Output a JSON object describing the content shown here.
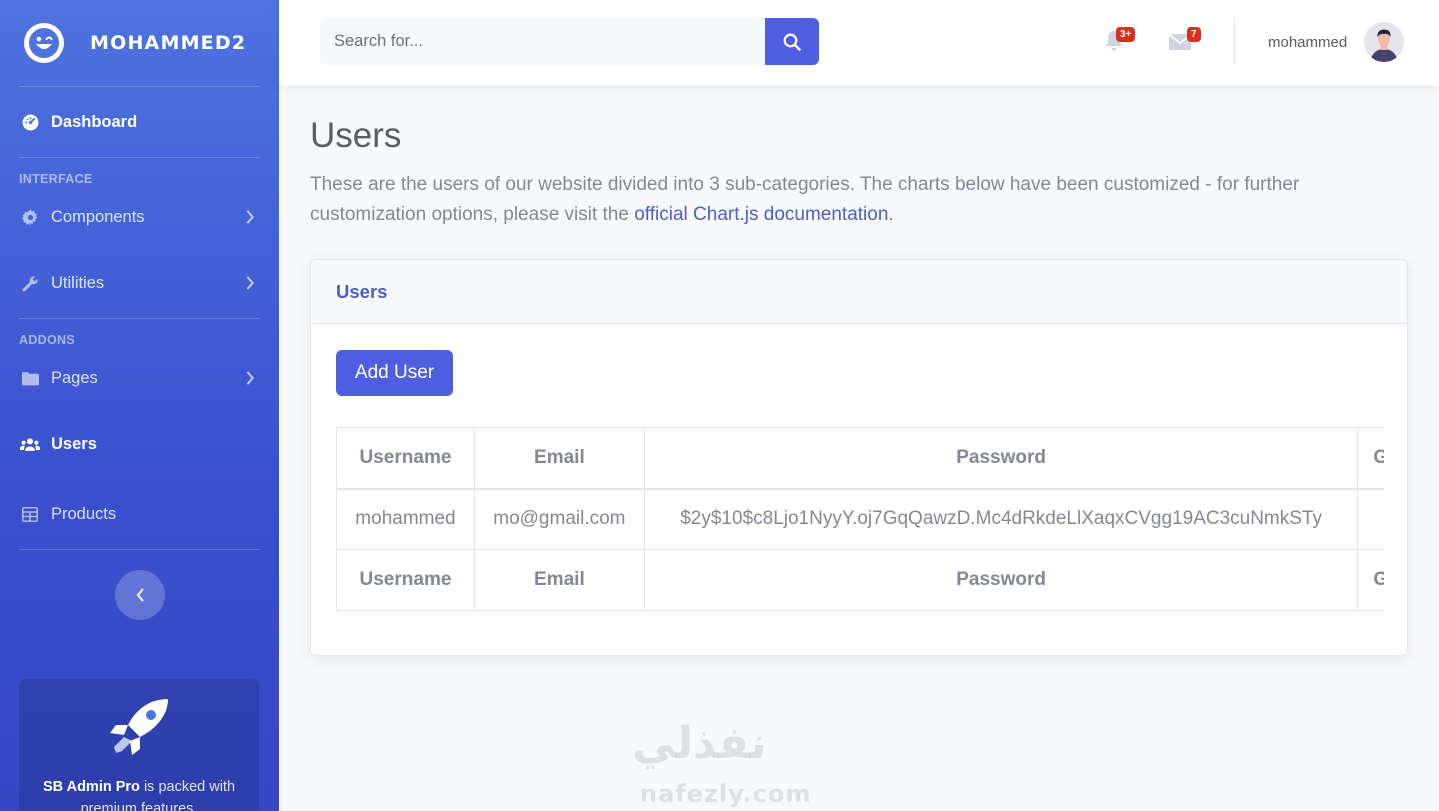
{
  "sidebar": {
    "brand": "MOHAMMED2",
    "dashboard": "Dashboard",
    "section_interface": "INTERFACE",
    "components": "Components",
    "utilities": "Utilities",
    "section_addons": "ADDONS",
    "pages": "Pages",
    "users": "Users",
    "products": "Products",
    "promo_bold": "SB Admin Pro",
    "promo_text": " is packed with premium features,"
  },
  "topbar": {
    "search_placeholder": "Search for...",
    "alerts_badge": "3+",
    "messages_badge": "7",
    "user_name": "mohammed"
  },
  "main": {
    "title": "Users",
    "desc_text": "These are the users of our website divided into 3 sub-categories. The charts below have been customized - for further customization options, please visit the ",
    "desc_link": "official Chart.js documentation",
    "desc_end": ".",
    "card_title": "Users",
    "add_button": "Add User",
    "table": {
      "headers": [
        "Username",
        "Email",
        "Password",
        "G"
      ],
      "rows": [
        [
          "mohammed",
          "mo@gmail.com",
          "$2y$10$c8Ljo1NyyY.oj7GqQawzD.Mc4dRkdeLlXaqxCVgg19AC3cuNmkSTy",
          ""
        ]
      ],
      "footers": [
        "Username",
        "Email",
        "Password",
        "G"
      ]
    }
  },
  "watermark": {
    "arabic": "نفذلي",
    "latin": "nafezly.com"
  },
  "colors": {
    "primary": "#4e73df",
    "accent": "#4e5ee0",
    "danger": "#e02d1b",
    "text": "#858796"
  }
}
